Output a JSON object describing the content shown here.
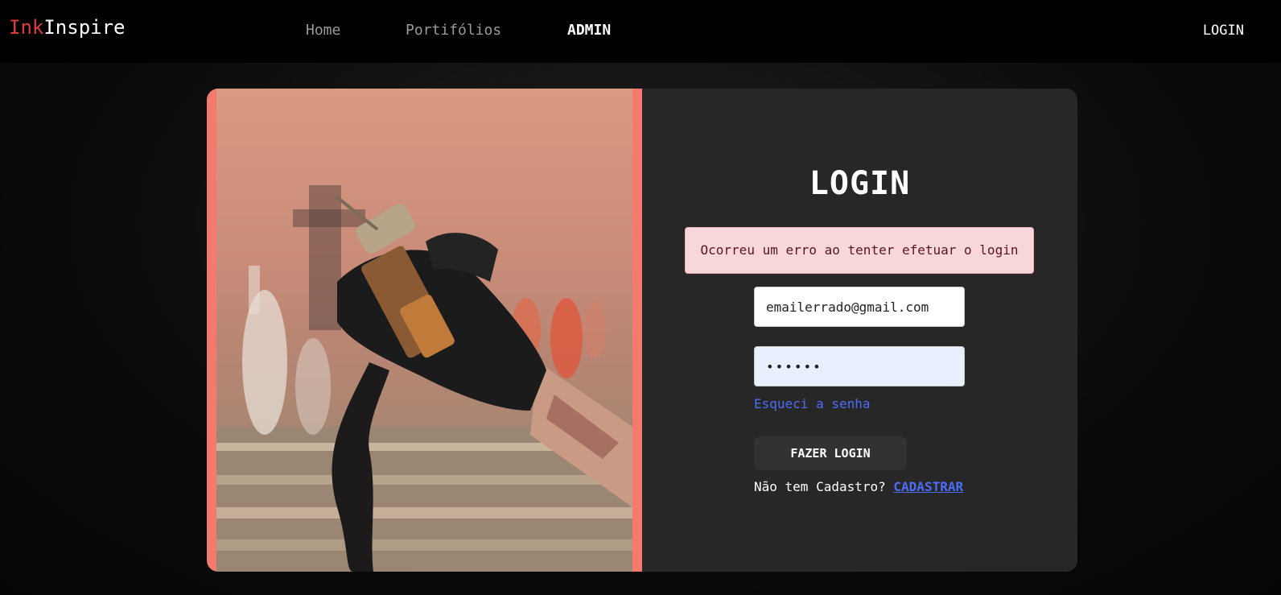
{
  "brand": {
    "part1": "Ink",
    "part2": "Inspire"
  },
  "nav": {
    "items": [
      {
        "label": "Home"
      },
      {
        "label": "Portifólios"
      },
      {
        "label": "ADMIN"
      }
    ],
    "login": "LOGIN"
  },
  "colors": {
    "accent": "#f47a6d",
    "link": "#4a6cf7",
    "brand_red": "#e03a3a"
  },
  "login_form": {
    "title": "LOGIN",
    "error": "Ocorreu um erro ao tenter efetuar o login",
    "email_value": "emailerrado@gmail.com",
    "password_value": "••••••",
    "forgot": "Esqueci a senha",
    "submit": "FAZER LOGIN",
    "no_account": "Não tem Cadastro?",
    "signup": "CADASTRAR"
  }
}
